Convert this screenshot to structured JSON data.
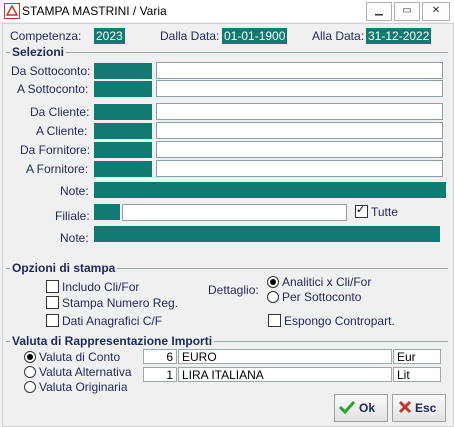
{
  "window": {
    "title": "STAMPA MASTRINI / Varia"
  },
  "header": {
    "competenza_label": "Competenza:",
    "competenza_value": "2023",
    "dalla_data_label": "Dalla Data:",
    "dalla_data_value": "01-01-1900",
    "alla_data_label": "Alla Data:",
    "alla_data_value": "31-12-2022"
  },
  "selezioni": {
    "title": "Selezioni",
    "da_sottoconto": "Da Sottoconto:",
    "a_sottoconto": "A  Sottoconto:",
    "da_cliente": "Da Cliente:",
    "a_cliente": "A  Cliente:",
    "da_fornitore": "Da Fornitore:",
    "a_fornitore": "A  Fornitore:",
    "note1": "Note:",
    "filiale": "Filiale:",
    "tutte": "Tutte",
    "tutte_checked": true,
    "note2": "Note:"
  },
  "opzioni": {
    "title": "Opzioni di stampa",
    "includo": "Includo Cli/For",
    "stampa_numero": "Stampa Numero Reg.",
    "dati_anagrafici": "Dati Anagrafici C/F",
    "dettaglio_label": "Dettaglio:",
    "analitici": "Analitici x Cli/For",
    "per_sottoconto": "Per Sottoconto",
    "dettaglio_selected": "analitici",
    "espongo": "Espongo Contropart."
  },
  "valuta": {
    "title": "Valuta di Rappresentazione Importi",
    "conto": "Valuta di Conto",
    "alternativa": "Valuta Alternativa",
    "originaria": "Valuta Originaria",
    "selected": "conto",
    "rows": [
      {
        "code": "6",
        "name": "EURO",
        "sym": "Eur"
      },
      {
        "code": "1",
        "name": "LIRA ITALIANA",
        "sym": "Lit"
      }
    ]
  },
  "buttons": {
    "ok": "Ok",
    "esc": "Esc"
  },
  "colors": {
    "field_teal": "#117a72",
    "label_navy": "#1e2a5a",
    "ok_green": "#2e9e2e",
    "esc_red": "#c0392b"
  }
}
